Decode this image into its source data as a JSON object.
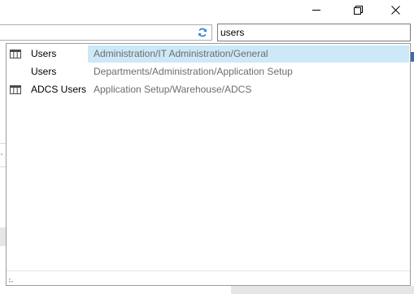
{
  "window": {
    "minimize_icon": "minimize-icon",
    "restore_icon": "restore-icon",
    "close_icon": "close-icon"
  },
  "address_bar": {
    "refresh_icon": "refresh-icon"
  },
  "search": {
    "value": "users"
  },
  "results": [
    {
      "name": "Users",
      "path": "Administration/IT Administration/General",
      "icon": "table-icon",
      "selected": true
    },
    {
      "name": "Users",
      "path": "Departments/Administration/Application Setup",
      "icon": "",
      "selected": false
    },
    {
      "name": "ADCS Users",
      "path": "Application Setup/Warehouse/ADCS",
      "icon": "table-icon",
      "selected": false
    }
  ],
  "colors": {
    "highlight": "#cde8f7",
    "refresh_icon": "#1e7fd6",
    "path_text": "#6d6d6d"
  }
}
